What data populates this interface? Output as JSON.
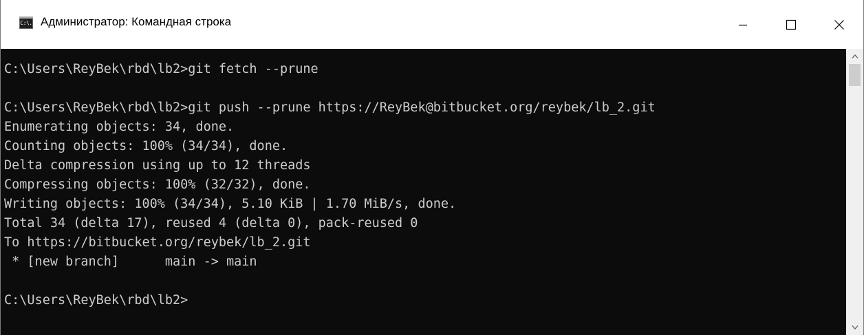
{
  "window": {
    "title": "Администратор: Командная строка",
    "icon_label": "C:\\."
  },
  "title_buttons": {
    "minimize_icon": "minimize-icon",
    "maximize_icon": "maximize-icon",
    "close_icon": "close-icon"
  },
  "console": {
    "background_color": "#0c0c0c",
    "text_color": "#cccccc",
    "lines": [
      "C:\\Users\\ReyBek\\rbd\\lb2>git fetch --prune",
      "",
      "C:\\Users\\ReyBek\\rbd\\lb2>git push --prune https://ReyBek@bitbucket.org/reybek/lb_2.git",
      "Enumerating objects: 34, done.",
      "Counting objects: 100% (34/34), done.",
      "Delta compression using up to 12 threads",
      "Compressing objects: 100% (32/32), done.",
      "Writing objects: 100% (34/34), 5.10 KiB | 1.70 MiB/s, done.",
      "Total 34 (delta 17), reused 4 (delta 0), pack-reused 0",
      "To https://bitbucket.org/reybek/lb_2.git",
      " * [new branch]      main -> main",
      "",
      "C:\\Users\\ReyBek\\rbd\\lb2>"
    ]
  },
  "scrollbar": {
    "up_icon": "chevron-up-icon",
    "down_icon": "chevron-down-icon"
  }
}
